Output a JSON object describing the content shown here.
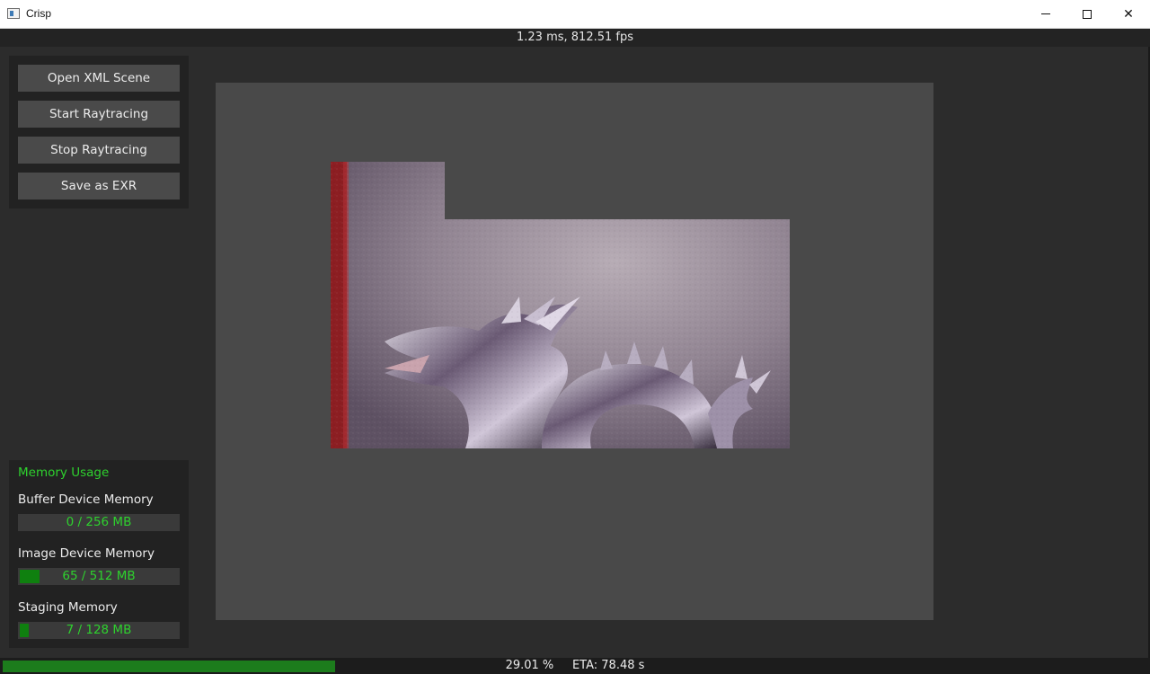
{
  "window": {
    "title": "Crisp",
    "icon": "app-window-icon",
    "controls": {
      "minimize": "minimize-icon",
      "maximize": "maximize-icon",
      "close": "close-icon",
      "close_glyph": "✕"
    }
  },
  "fps_bar": {
    "text": "1.23 ms, 812.51 fps"
  },
  "controls": {
    "open_xml_scene": "Open XML Scene",
    "start_raytracing": "Start Raytracing",
    "stop_raytracing": "Stop Raytracing",
    "save_as_exr": "Save as EXR"
  },
  "memory": {
    "heading": "Memory Usage",
    "items": [
      {
        "label": "Buffer Device Memory",
        "value": "0 / 256 MB",
        "fraction": 0.0
      },
      {
        "label": "Image Device Memory",
        "value": "65 / 512 MB",
        "fraction": 0.127
      },
      {
        "label": "Staging Memory",
        "value": "7 / 128 MB",
        "fraction": 0.055
      }
    ],
    "accent": "#2ed12e"
  },
  "progress": {
    "percent_text": "29.01 %",
    "eta_text": "ETA: 78.48 s",
    "fraction": 0.2901,
    "color": "#1c7c1c"
  },
  "viewport": {
    "render_content": "dragon-render-image"
  }
}
